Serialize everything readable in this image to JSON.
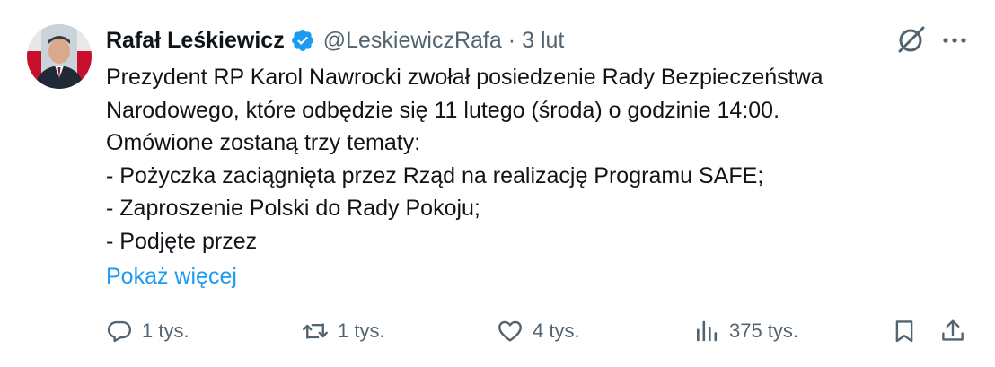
{
  "author": {
    "name": "Rafał Leśkiewicz",
    "handle": "@LeskiewiczRafa",
    "separator": "·",
    "time": "3 lut",
    "verified_icon": "verified-badge-icon",
    "verified_color": "#1d9bf0"
  },
  "tweet": {
    "text": "Prezydent RP Karol Nawrocki zwołał posiedzenie Rady Bezpieczeństwa\nNarodowego, które odbędzie się 11 lutego (środa) o godzinie 14:00.\nOmówione zostaną trzy tematy:\n- Pożyczka zaciągnięta przez Rząd na realizację Programu SAFE;\n- Zaproszenie Polski do Rady Pokoju;\n- Podjęte przez",
    "show_more": "Pokaż więcej"
  },
  "actions": {
    "reply": {
      "icon": "reply-icon",
      "count": "1 tys."
    },
    "retweet": {
      "icon": "retweet-icon",
      "count": "1 tys."
    },
    "like": {
      "icon": "heart-icon",
      "count": "4 tys."
    },
    "views": {
      "icon": "views-icon",
      "count": "375 tys."
    },
    "bookmark": {
      "icon": "bookmark-icon"
    },
    "share": {
      "icon": "share-icon"
    }
  },
  "colors": {
    "text": "#0f1419",
    "secondary": "#536471",
    "link": "#1d9bf0"
  }
}
